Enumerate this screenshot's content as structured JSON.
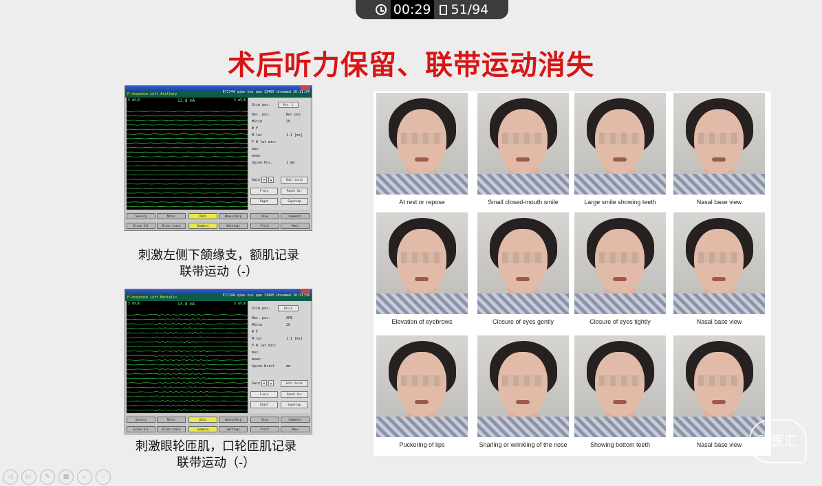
{
  "player": {
    "elapsed": "00:29",
    "page": "51/94"
  },
  "slide": {
    "title": "术后听力保留、联带运动消失",
    "caption1": [
      "刺激左侧下颌缘支，额肌记录",
      "联带运动（-）"
    ],
    "caption2": [
      "刺激眼轮匝肌，口轮匝肌记录",
      "联带运动（-）"
    ]
  },
  "emg1": {
    "hdr_left": "F-response    Left Axillary",
    "hdr_right": "E71744 qian hui que 13495  Unnamed  10:11:54",
    "scale_left": "5 mV/D",
    "stim": "13.8 mA",
    "scale_right": "5 mV/D",
    "stim_pos_label": "Stim pos.",
    "stim_pos_value": "Pos. 1",
    "rows": [
      {
        "k": "Rec. pos.",
        "v": "Rec pos"
      },
      {
        "k": "#Stim",
        "v": "20"
      },
      {
        "k": "# F",
        "v": ""
      },
      {
        "k": "M-lat",
        "v": "1.1 [ms]"
      },
      {
        "k": "F-W lat min:",
        "v": ""
      },
      {
        "k": "max:",
        "v": ""
      },
      {
        "k": "mean:",
        "v": ""
      },
      {
        "k": "Spine-Pos.",
        "v": "1 mm"
      }
    ],
    "gain_label": "Gain",
    "side_buttons": [
      "Edit tests",
      "F-min",
      "Reset Cur",
      "Right",
      "Superimp",
      "View",
      "Comments",
      "Print",
      "Menu"
    ],
    "bottom_buttons": [
      "Sensory",
      "Motor",
      "Data",
      "Waves/Resp",
      "Erase all",
      "Erase trace",
      "Summary",
      "Settings"
    ]
  },
  "emg2": {
    "hdr_left": "F-response    Left Mentalis",
    "hdr_right": "E71744 qian hui que 13495  Unnamed  10:11:54",
    "scale_left": "5 mV/D",
    "stim": "13.8 mA",
    "scale_right": "5 mV/D",
    "stim_pos_label": "Stim pos.",
    "stim_pos_value": "Wrist",
    "rows": [
      {
        "k": "Rec. pos.",
        "v": "APB"
      },
      {
        "k": "#Stim",
        "v": "20"
      },
      {
        "k": "# F",
        "v": ""
      },
      {
        "k": "M-lat",
        "v": "1.1 [ms]"
      },
      {
        "k": "F-W lat min:",
        "v": ""
      },
      {
        "k": "max:",
        "v": ""
      },
      {
        "k": "mean:",
        "v": ""
      },
      {
        "k": "Spine-Wrist",
        "v": "mm"
      }
    ],
    "gain_label": "Gain",
    "side_buttons": [
      "Edit tests",
      "F-min",
      "Reset Cur",
      "Right",
      "Superimp",
      "View",
      "Comments",
      "Print",
      "Menu"
    ],
    "bottom_buttons": [
      "Sensory",
      "Motor",
      "Data",
      "Waves/Resp",
      "Erase all",
      "Erase trace",
      "Summary",
      "Settings"
    ]
  },
  "photos": [
    "At rest  or repose",
    "Small closed-mouth smile",
    "Large smile showing teeth",
    "Nasal base view",
    "Elevation of  eyebrows",
    "Closure of eyes gently",
    "Closure of eyes tightly",
    "Nasal base view",
    "Puckering of  lips",
    "Snarling or wrinkling of the nose",
    "Showing bottom teeth",
    "Nasal base view"
  ],
  "watermark": "脑医汇",
  "colors": {
    "title": "#d81515",
    "trace": "#3fe04a",
    "header": "#0d5c4a"
  }
}
